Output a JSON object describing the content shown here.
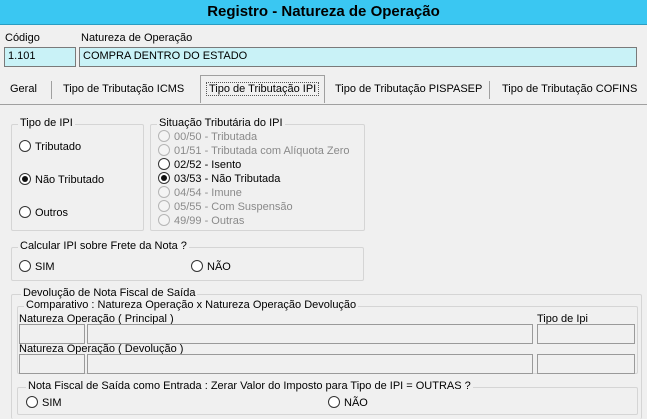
{
  "window": {
    "title": "Registro - Natureza de Operação"
  },
  "header": {
    "codigo_label": "Código",
    "codigo_value": "1.101",
    "natureza_label": "Natureza de Operação",
    "natureza_value": "COMPRA DENTRO DO ESTADO"
  },
  "tabs": [
    {
      "label": "Geral"
    },
    {
      "label": "Tipo de Tributação  ICMS"
    },
    {
      "label": "Tipo de Tributação IPI",
      "active": true
    },
    {
      "label": "Tipo de Tributação PISPASEP"
    },
    {
      "label": "Tipo de Tributação COFINS"
    }
  ],
  "tipo_ipi": {
    "label": "Tipo de IPI",
    "options": [
      {
        "label": "Tributado",
        "checked": false
      },
      {
        "label": "Não Tributado",
        "checked": true
      },
      {
        "label": "Outros",
        "checked": false
      }
    ]
  },
  "situacao": {
    "label": "Situação Tributária do IPI",
    "options": [
      {
        "label": "00/50 - Tributada",
        "checked": false,
        "enabled": false
      },
      {
        "label": "01/51 - Tributada com Alíquota Zero",
        "checked": false,
        "enabled": false
      },
      {
        "label": "02/52 - Isento",
        "checked": false,
        "enabled": true
      },
      {
        "label": "03/53 - Não Tributada",
        "checked": true,
        "enabled": true
      },
      {
        "label": "04/54 - Imune",
        "checked": false,
        "enabled": false
      },
      {
        "label": "05/55 - Com Suspensão",
        "checked": false,
        "enabled": false
      },
      {
        "label": "49/99 - Outras",
        "checked": false,
        "enabled": false
      }
    ]
  },
  "frete": {
    "label": "Calcular IPI sobre Frete da Nota ?",
    "sim": "SIM",
    "nao": "NÃO"
  },
  "devolucao": {
    "label": "Devolução de Nota Fiscal de Saída",
    "comparativo_label": "Comparativo : Natureza Operação x Natureza Operação Devolução",
    "principal_label": "Natureza Operação ( Principal )",
    "tipo_ipi_label": "Tipo de Ipi",
    "devolucao_label": "Natureza Operação ( Devolução )",
    "entrada_label": "Nota Fiscal de Saída como Entrada : Zerar Valor do Imposto para Tipo de IPI = OUTRAS ?",
    "sim": "SIM",
    "nao": "NÃO"
  }
}
